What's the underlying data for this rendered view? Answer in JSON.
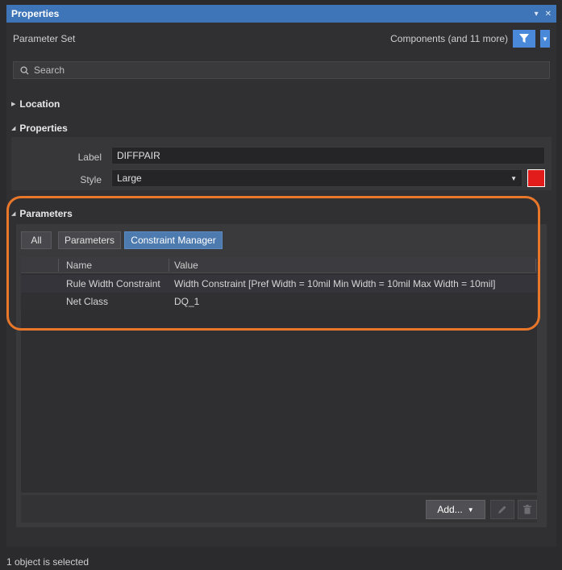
{
  "window": {
    "title": "Properties",
    "pin_icon": "pin-icon",
    "close_icon": "close-icon"
  },
  "parameter_set": {
    "label": "Parameter Set",
    "scope": "Components (and 11 more)",
    "filter_icon": "funnel-icon"
  },
  "search": {
    "placeholder": "Search",
    "icon": "search-icon"
  },
  "sections": {
    "location": {
      "title": "Location",
      "expanded": false
    },
    "properties": {
      "title": "Properties",
      "expanded": true
    },
    "parameters": {
      "title": "Parameters",
      "expanded": true
    }
  },
  "properties": {
    "label_caption": "Label",
    "label_value": "DIFFPAIR",
    "style_caption": "Style",
    "style_value": "Large",
    "color": "#e21b1b"
  },
  "parameters": {
    "tabs": [
      {
        "label": "All",
        "active": false
      },
      {
        "label": "Parameters",
        "active": false
      },
      {
        "label": "Constraint Manager",
        "active": true
      }
    ],
    "columns": {
      "name": "Name",
      "value": "Value"
    },
    "rows": [
      {
        "name": "Rule Width Constraint",
        "value": "Width Constraint [Pref Width = 10mil   Min Width = 10mil   Max Width = 10mil]"
      },
      {
        "name": "Net Class",
        "value": "DQ_1"
      }
    ],
    "add_label": "Add...",
    "edit_icon": "pencil-icon",
    "delete_icon": "trash-icon"
  },
  "highlight_color": "#e8772a",
  "status": "1 object is selected"
}
